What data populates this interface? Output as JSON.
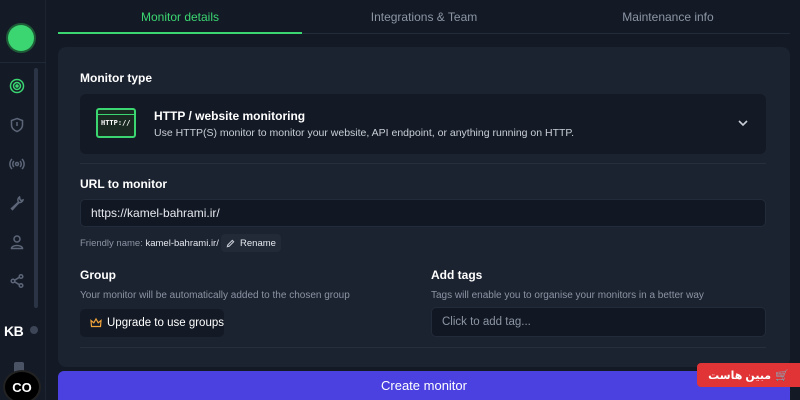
{
  "tabs": [
    {
      "label": "Monitor details",
      "active": true
    },
    {
      "label": "Integrations & Team",
      "active": false
    },
    {
      "label": "Maintenance info",
      "active": false
    }
  ],
  "sidebar": {
    "avatar_initials": "KB",
    "icons": [
      "radar-icon",
      "shield-icon",
      "broadcast-icon",
      "wrench-icon",
      "user-icon",
      "share-icon"
    ]
  },
  "monitor_type": {
    "label": "Monitor type",
    "thumb_text": "HTTP://",
    "title": "HTTP / website monitoring",
    "description": "Use HTTP(S) monitor to monitor your website, API endpoint, or anything running on HTTP."
  },
  "url": {
    "label": "URL to monitor",
    "value": "https://kamel-bahrami.ir/"
  },
  "friendly_name": {
    "prefix": "Friendly name:",
    "value": "kamel-bahrami.ir/",
    "rename_label": "Rename"
  },
  "group": {
    "label": "Group",
    "hint": "Your monitor will be automatically added to the chosen group",
    "upgrade_label": "Upgrade to use groups"
  },
  "tags": {
    "label": "Add tags",
    "hint": "Tags will enable you to organise your monitors in a better way",
    "placeholder": "Click to add tag..."
  },
  "create_label": "Create monitor",
  "co_button_label": "CO",
  "brand_badge": "مبین هاست",
  "colors": {
    "accent": "#3bd671",
    "primary_button": "#4a41e0",
    "badge": "#e03436"
  }
}
